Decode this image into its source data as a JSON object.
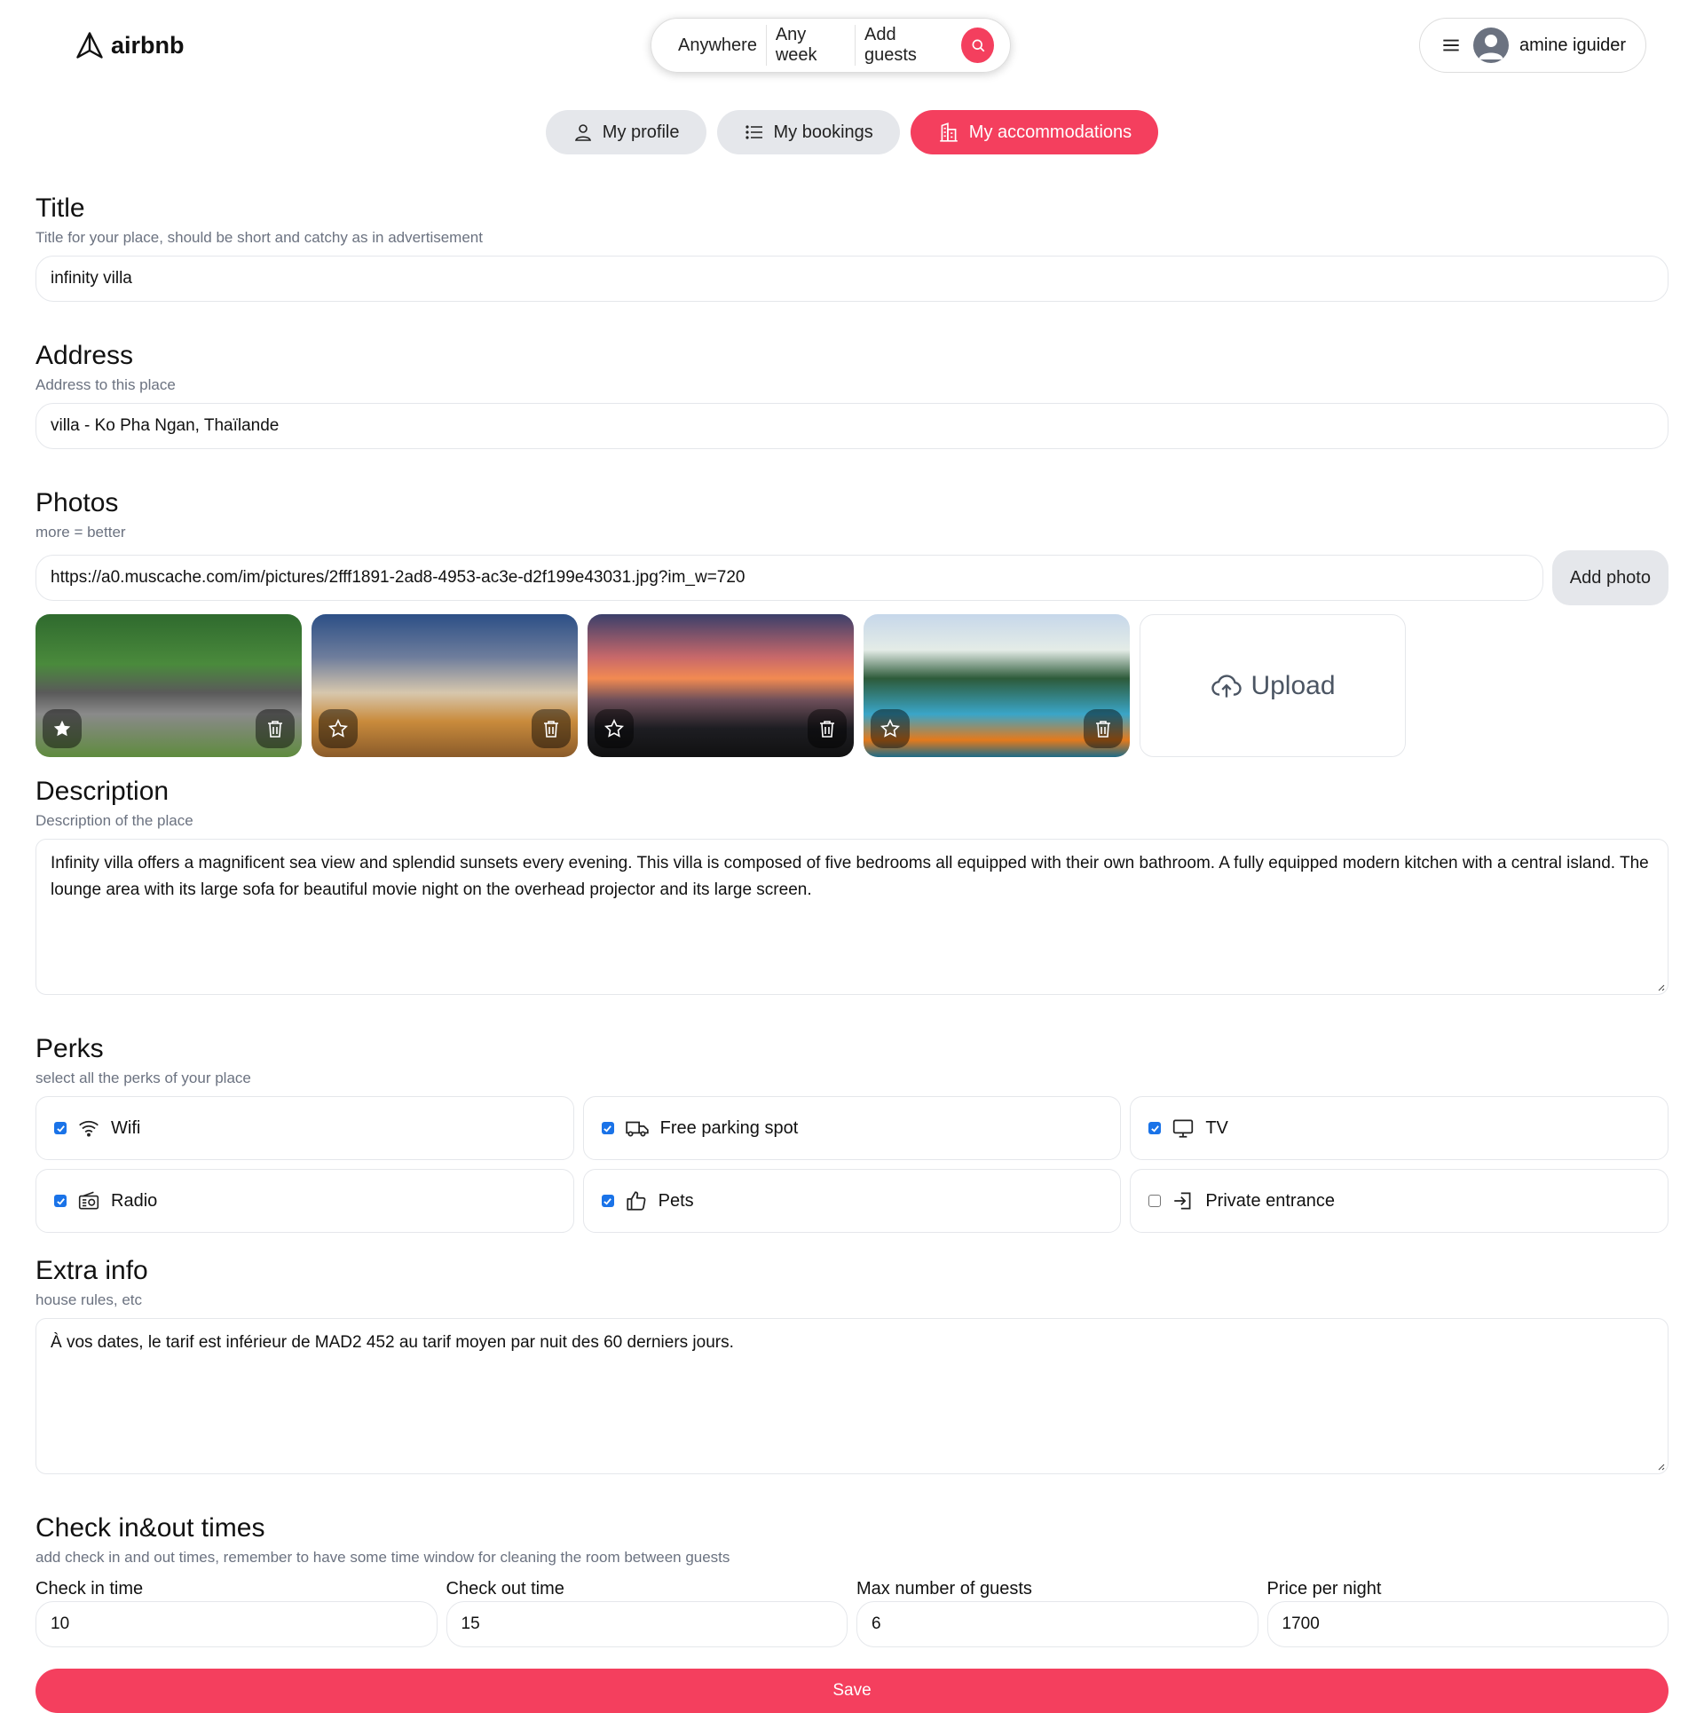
{
  "app": {
    "name": "airbnb"
  },
  "search": {
    "anywhere": "Anywhere",
    "any_week": "Any week",
    "add_guests": "Add guests"
  },
  "user": {
    "name": "amine iguider"
  },
  "tabs": [
    {
      "label": "My profile",
      "icon": "user-icon",
      "active": false
    },
    {
      "label": "My bookings",
      "icon": "list-icon",
      "active": false
    },
    {
      "label": "My accommodations",
      "icon": "building-icon",
      "active": true
    }
  ],
  "form": {
    "title": {
      "heading": "Title",
      "sub": "Title for your place, should be short and catchy as in advertisement",
      "value": "infinity villa"
    },
    "address": {
      "heading": "Address",
      "sub": "Address to this place",
      "value": "villa - Ko Pha Ngan, Thaïlande"
    },
    "photos": {
      "heading": "Photos",
      "sub": "more = better",
      "link_value": "https://a0.muscache.com/im/pictures/2fff1891-2ad8-4953-ac3e-d2f199e43031.jpg?im_w=720",
      "add_label": "Add photo",
      "upload_label": "Upload",
      "items": [
        {
          "main": true,
          "icon": "star-filled-icon"
        },
        {
          "main": false,
          "icon": "star-outline-icon"
        },
        {
          "main": false,
          "icon": "star-outline-icon"
        },
        {
          "main": false,
          "icon": "star-outline-icon"
        }
      ]
    },
    "description": {
      "heading": "Description",
      "sub": "Description of the place",
      "value": "Infinity villa offers a magnificent sea view and splendid sunsets every evening. This villa is composed of five bedrooms all equipped with their own bathroom. A fully equipped modern kitchen with a central island.  The lounge area with   its large sofa for beautiful movie night on the overhead projector and its large screen."
    },
    "perks": {
      "heading": "Perks",
      "sub": "select all the perks of your place",
      "items": [
        {
          "label": "Wifi",
          "checked": true,
          "icon": "wifi-icon"
        },
        {
          "label": "Free parking spot",
          "checked": true,
          "icon": "truck-icon"
        },
        {
          "label": "TV",
          "checked": true,
          "icon": "tv-icon"
        },
        {
          "label": "Radio",
          "checked": true,
          "icon": "radio-icon"
        },
        {
          "label": "Pets",
          "checked": true,
          "icon": "thumbs-up-icon"
        },
        {
          "label": "Private entrance",
          "checked": false,
          "icon": "enter-icon"
        }
      ]
    },
    "extra": {
      "heading": "Extra info",
      "sub": "house rules, etc",
      "value": "À vos dates, le tarif est inférieur de MAD2 452 au tarif moyen par nuit des 60 derniers jours."
    },
    "times": {
      "heading": "Check in&out times",
      "sub": "add check in and out times, remember to have some time window for cleaning the room between guests",
      "check_in_label": "Check in time",
      "check_in_value": "10",
      "check_out_label": "Check out time",
      "check_out_value": "15",
      "max_guests_label": "Max number of guests",
      "max_guests_value": "6",
      "price_label": "Price per night",
      "price_value": "1700"
    },
    "save_label": "Save"
  },
  "colors": {
    "accent": "#f43f5e",
    "checkbox": "#1a73e8",
    "muted": "#6b7280",
    "border": "#e5e7eb"
  }
}
